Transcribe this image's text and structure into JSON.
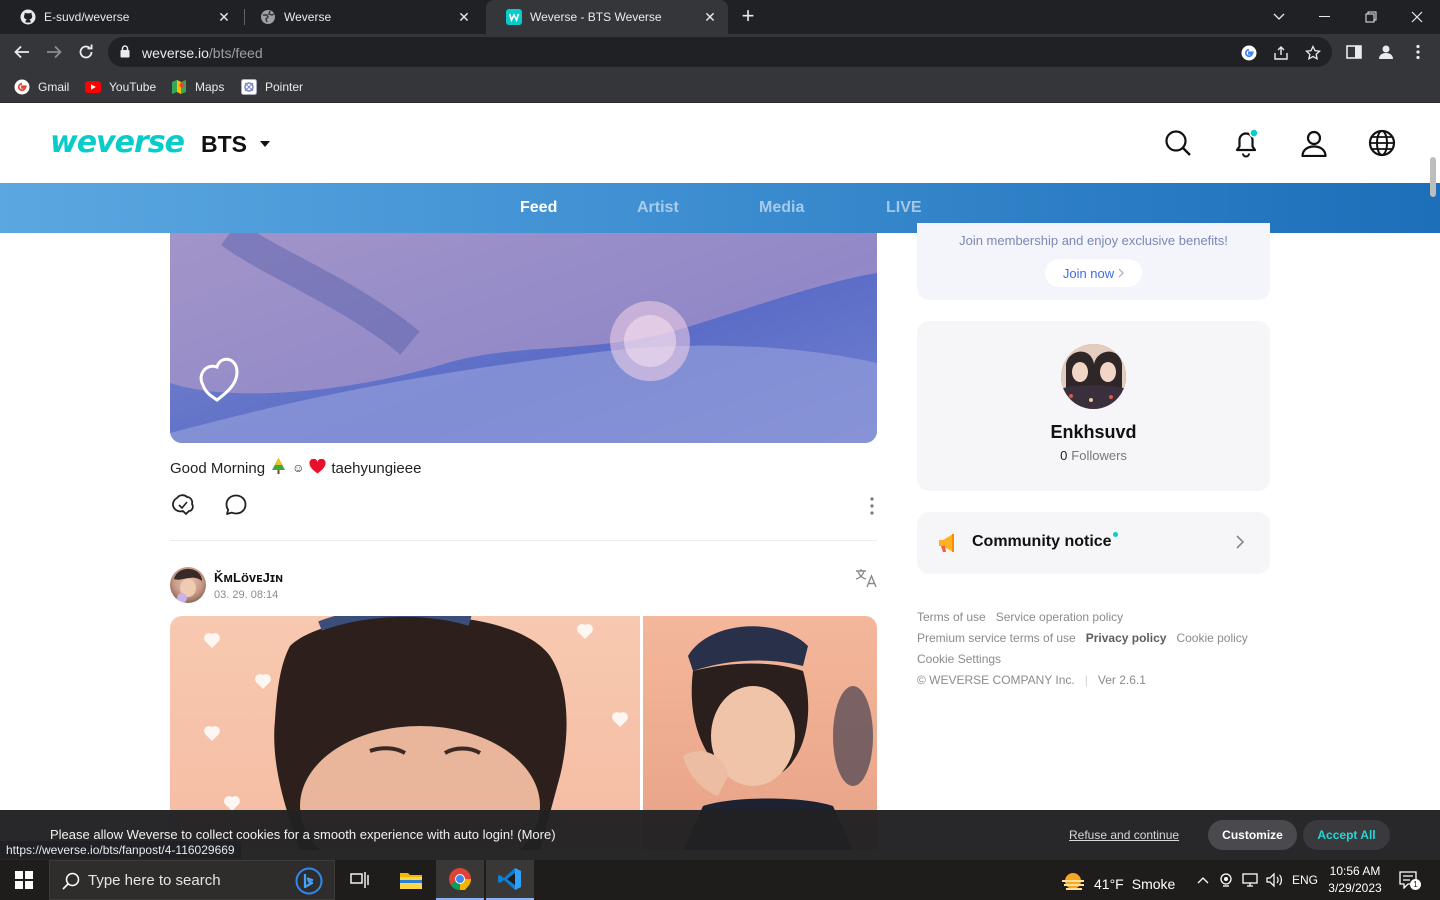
{
  "browser": {
    "tabs": [
      {
        "title": "E-suvd/weverse",
        "favicon": "github-icon",
        "active": false
      },
      {
        "title": "Weverse",
        "favicon": "globe-icon",
        "active": false
      },
      {
        "title": "Weverse - BTS Weverse",
        "favicon": "weverse-icon",
        "active": true
      }
    ],
    "address": {
      "host": "weverse.io",
      "path": "/bts/feed"
    },
    "bookmarks": [
      {
        "label": "Gmail",
        "icon": "google-icon"
      },
      {
        "label": "YouTube",
        "icon": "youtube-icon"
      },
      {
        "label": "Maps",
        "icon": "maps-icon"
      },
      {
        "label": "Pointer",
        "icon": "pointer-icon"
      }
    ],
    "status_url": "https://weverse.io/bts/fanpost/4-116029669"
  },
  "header": {
    "logo": "weverse",
    "community": "BTS",
    "nav": [
      {
        "label": "Feed",
        "active": true
      },
      {
        "label": "Artist",
        "active": false
      },
      {
        "label": "Media",
        "active": false
      },
      {
        "label": "LIVE",
        "active": false
      }
    ]
  },
  "feed": {
    "post1": {
      "text_start": "Good Morning",
      "text_smile": "☺",
      "author_tag": "taehyungieee"
    },
    "post2": {
      "author": "ǨᴍLöᴠᴇJɪɴ",
      "date": "03. 29. 08:14"
    }
  },
  "sidebar": {
    "membership": {
      "text": "Join membership and enjoy exclusive benefits!",
      "button": "Join now"
    },
    "profile": {
      "name": "Enkhsuvd",
      "followers_count": "0",
      "followers_label": "Followers"
    },
    "notice": {
      "label": "Community notice"
    },
    "footer": {
      "terms": "Terms of use",
      "service": "Service operation policy",
      "premium": "Premium service terms of use",
      "privacy": "Privacy policy",
      "cookie_policy": "Cookie policy",
      "cookie_settings": "Cookie Settings",
      "copyright": "© WEVERSE COMPANY Inc.",
      "version": "Ver 2.6.1"
    }
  },
  "cookie_banner": {
    "text": "Please allow Weverse to collect cookies for a smooth experience with auto login! (More)",
    "refuse": "Refuse and continue",
    "customize": "Customize",
    "accept": "Accept All"
  },
  "taskbar": {
    "search_placeholder": "Type here to search",
    "weather_temp": "41°F",
    "weather_desc": "Smoke",
    "language": "ENG",
    "time": "10:56 AM",
    "date": "3/29/2023",
    "notification_count": "1"
  },
  "colors": {
    "brand": "#08ccca",
    "nav_gradient_start": "#5ba7e0",
    "nav_gradient_end": "#1c6fb8",
    "accept": "#23d6d4"
  }
}
